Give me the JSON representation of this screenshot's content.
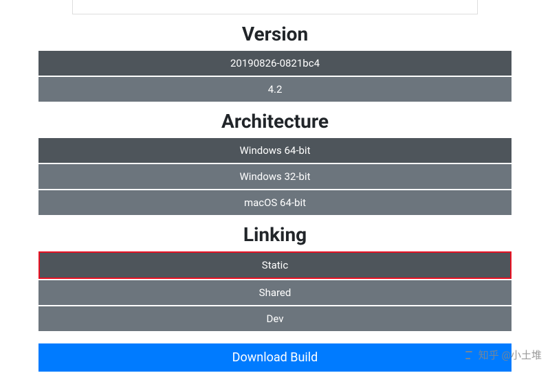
{
  "sections": {
    "version": {
      "title": "Version",
      "options": [
        {
          "label": "20190826-0821bc4",
          "selected": true
        },
        {
          "label": "4.2",
          "selected": false
        }
      ]
    },
    "architecture": {
      "title": "Architecture",
      "options": [
        {
          "label": "Windows 64-bit",
          "selected": true
        },
        {
          "label": "Windows 32-bit",
          "selected": false
        },
        {
          "label": "macOS 64-bit",
          "selected": false
        }
      ]
    },
    "linking": {
      "title": "Linking",
      "options": [
        {
          "label": "Static",
          "selected": true,
          "highlighted": true
        },
        {
          "label": "Shared",
          "selected": false
        },
        {
          "label": "Dev",
          "selected": false
        }
      ]
    }
  },
  "download": {
    "label": "Download Build"
  },
  "watermark": {
    "text": "知乎 @小土堆"
  }
}
